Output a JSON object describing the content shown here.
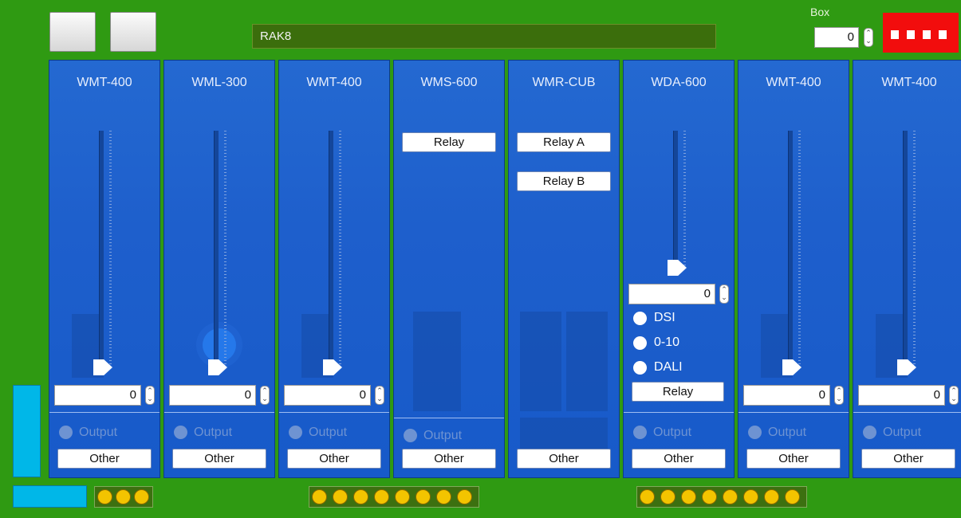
{
  "header": {
    "title": "RAK8",
    "box_label": "Box",
    "box_value": "0"
  },
  "colors": {
    "board": "#2f9a12",
    "module": "#1e5fcc",
    "dip_switch": "#f20d0d",
    "led": "#f3c400",
    "side_bar": "#00b7e8"
  },
  "icons": {
    "stepper": "up-down-arrows-icon",
    "slider_thumb": "triangle-pointer-icon",
    "radio": "radio-button-icon",
    "led": "led-indicator-icon"
  },
  "modules": [
    {
      "name": "WMT-400",
      "value": "0",
      "output": "Output",
      "other": "Other"
    },
    {
      "name": "WML-300",
      "value": "0",
      "output": "Output",
      "other": "Other"
    },
    {
      "name": "WMT-400",
      "value": "0",
      "output": "Output",
      "other": "Other"
    },
    {
      "name": "WMS-600",
      "relay": "Relay",
      "output": "Output",
      "other": "Other"
    },
    {
      "name": "WMR-CUB",
      "relay_a": "Relay A",
      "relay_b": "Relay B",
      "other": "Other"
    },
    {
      "name": "WDA-600",
      "value": "0",
      "options": [
        "DSI",
        "0-10",
        "DALI"
      ],
      "relay": "Relay",
      "output": "Output",
      "other": "Other"
    },
    {
      "name": "WMT-400",
      "value": "0",
      "output": "Output",
      "other": "Other"
    },
    {
      "name": "WMT-400",
      "value": "0",
      "output": "Output",
      "other": "Other"
    }
  ],
  "led_groups": [
    3,
    8,
    8
  ]
}
